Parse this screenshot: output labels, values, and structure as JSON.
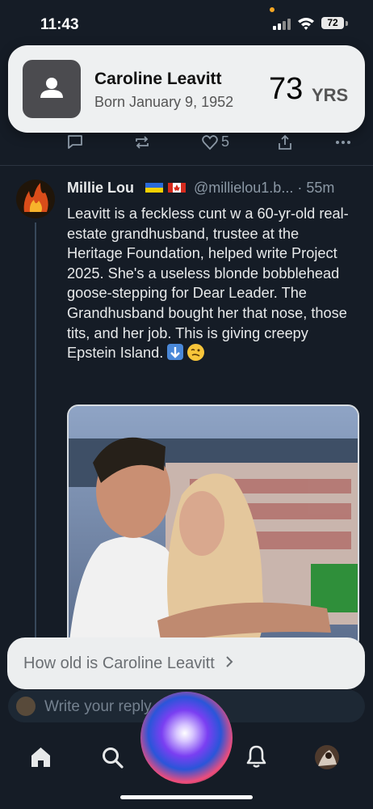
{
  "status_bar": {
    "time": "11:43",
    "battery": "72"
  },
  "siri_answer": {
    "name": "Caroline Leavitt",
    "born": "Born January 9, 1952",
    "age_value": "73",
    "age_unit": "YRS"
  },
  "previous_post_actions": {
    "like_count": "5"
  },
  "post": {
    "author": "Millie Lou",
    "flags": [
      "ukraine-flag",
      "canada-flag"
    ],
    "handle": "@millielou1.b... · 55m",
    "text": "Leavitt is a feckless cunt w a 60-yr-old real-estate grandhusband, trustee at the Heritage Foundation, helped write Project 2025. She's a useless blonde bobblehead goose-stepping for Dear Leader. The Grandhusband bought her that nose, those tits, and her job. This is giving creepy Epstein Island."
  },
  "siri_suggestion": {
    "text": "How old is Caroline Leavitt"
  },
  "reply": {
    "placeholder": "Write your reply..."
  },
  "tab_bar": {
    "items": [
      "home-icon",
      "search-icon",
      "siri-orb",
      "notifications-icon",
      "profile-avatar"
    ]
  },
  "colors": {
    "background": "#151c26",
    "card": "#eef0f1",
    "link": "#8b98a5"
  }
}
